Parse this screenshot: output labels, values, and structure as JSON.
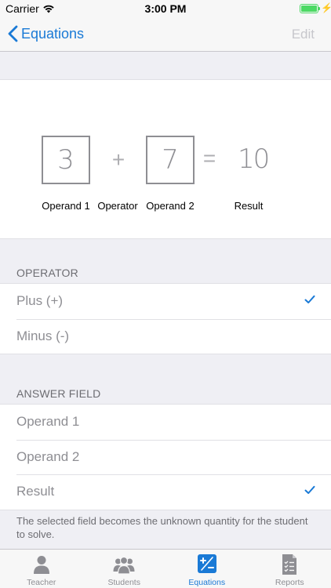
{
  "status_bar": {
    "carrier": "Carrier",
    "time": "3:00 PM"
  },
  "nav": {
    "back_label": "Equations",
    "edit_label": "Edit"
  },
  "equation": {
    "operand1": "3",
    "operator_symbol": "+",
    "operand2": "7",
    "equals": "=",
    "result": "10",
    "captions": {
      "operand1": "Operand 1",
      "operator": "Operator",
      "operand2": "Operand 2",
      "result": "Result"
    }
  },
  "operator_section": {
    "header": "OPERATOR",
    "items": [
      {
        "label": "Plus (+)",
        "selected": true
      },
      {
        "label": "Minus (-)",
        "selected": false
      }
    ]
  },
  "answer_section": {
    "header": "ANSWER FIELD",
    "items": [
      {
        "label": "Operand 1",
        "selected": false
      },
      {
        "label": "Operand 2",
        "selected": false
      },
      {
        "label": "Result",
        "selected": true
      }
    ],
    "footer": "The selected field becomes the unknown quantity for the student to solve."
  },
  "tabs": [
    {
      "label": "Teacher",
      "icon": "person-icon",
      "active": false
    },
    {
      "label": "Students",
      "icon": "group-icon",
      "active": false
    },
    {
      "label": "Equations",
      "icon": "plus-minus-icon",
      "active": true
    },
    {
      "label": "Reports",
      "icon": "report-icon",
      "active": false
    }
  ],
  "colors": {
    "accent": "#1a7ad6",
    "inactive": "#8e8e93",
    "background": "#efeff4"
  }
}
